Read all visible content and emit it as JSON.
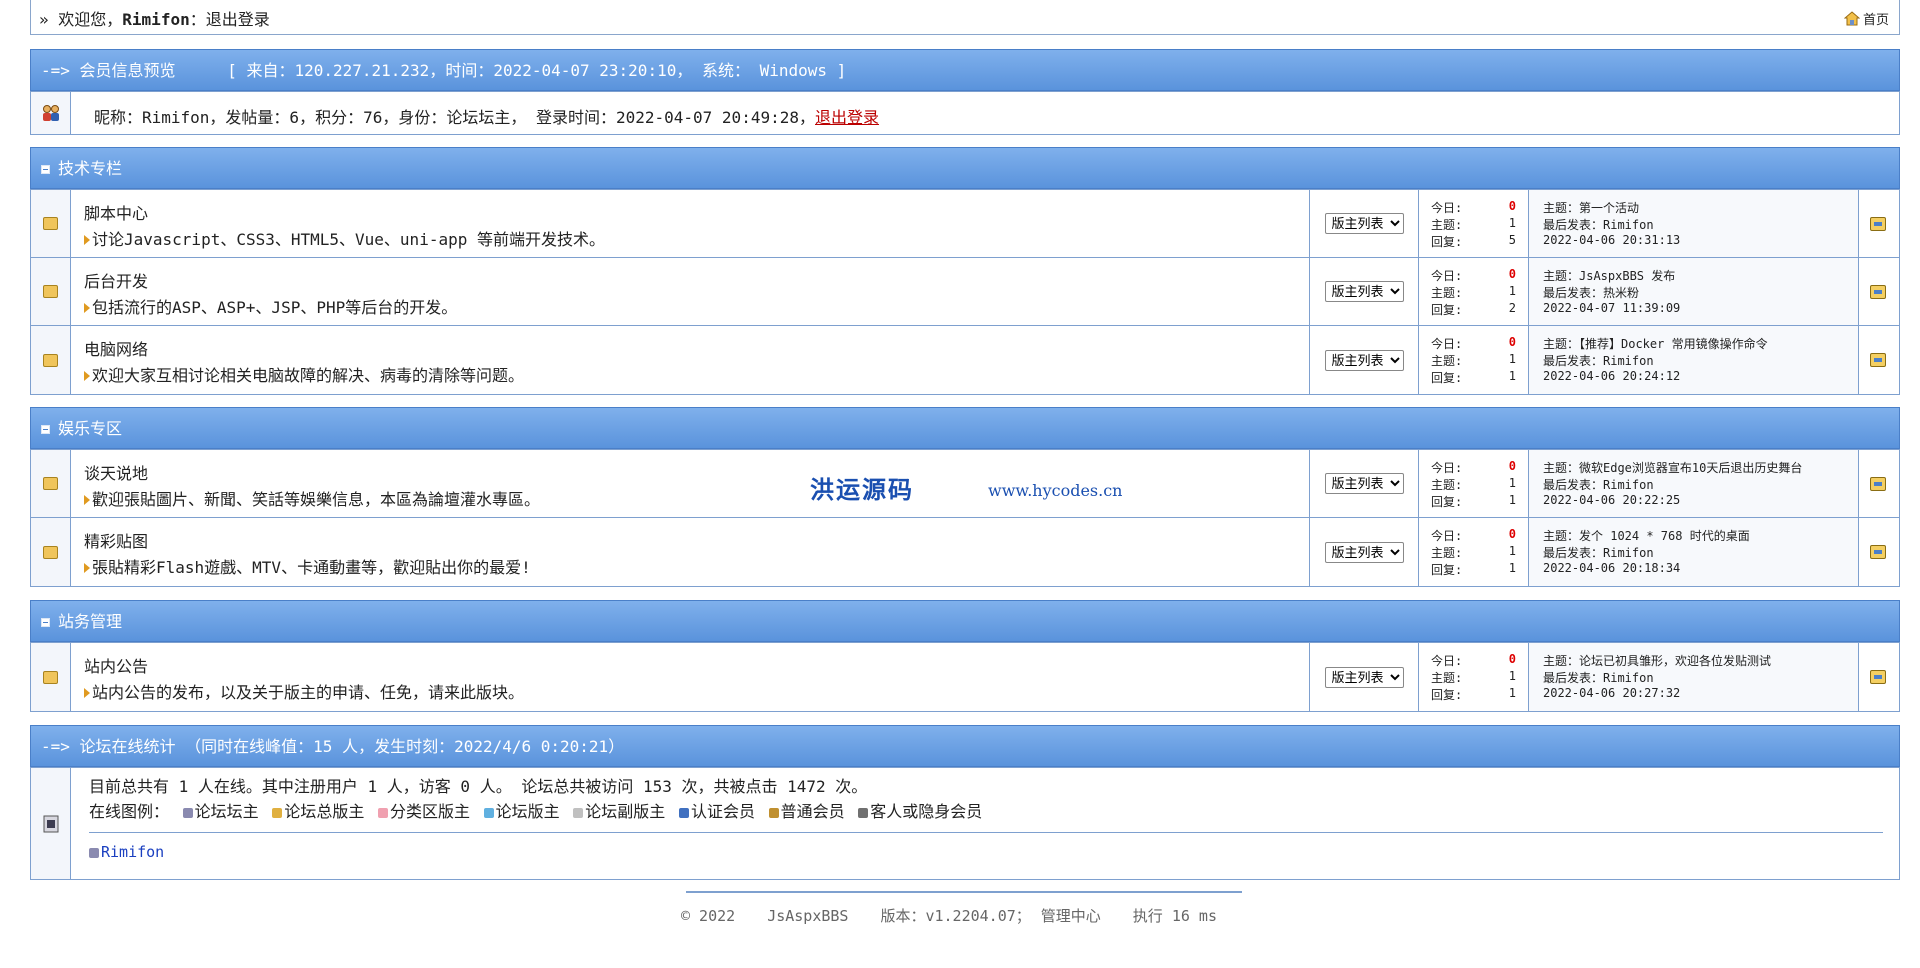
{
  "top": {
    "prefix": "» 欢迎您，",
    "user": "Rimifon",
    "sep": "：",
    "logout": "退出登录",
    "home": "首页"
  },
  "member": {
    "head_label": "-=> 会员信息预览",
    "head_info": "[ 来自：120.227.21.232，时间：2022-04-07 23:20:10，  系统：  Windows ]",
    "line": "昵称：Rimifon，发帖量：6，积分：76，身份：论坛坛主，  登录时间：2022-04-07 20:49:28，",
    "logout": "退出登录"
  },
  "categories": [
    {
      "title": "技术专栏",
      "forums": [
        {
          "name": "脚本中心",
          "desc": "讨论Javascript、CSS3、HTML5、Vue、uni-app 等前端开发技术。",
          "mod": "版主列表",
          "today": "0",
          "topics": "1",
          "replies": "5",
          "last_topic": "主题：第一个活动",
          "last_poster": "最后发表：Rimifon",
          "last_time": "2022-04-06 20:31:13"
        },
        {
          "name": "后台开发",
          "desc": "包括流行的ASP、ASP+、JSP、PHP等后台的开发。",
          "mod": "版主列表",
          "today": "0",
          "topics": "1",
          "replies": "2",
          "last_topic": "主题：JsAspxBBS 发布",
          "last_poster": "最后发表：热米粉",
          "last_time": "2022-04-07 11:39:09"
        },
        {
          "name": "电脑网络",
          "desc": "欢迎大家互相讨论相关电脑故障的解决、病毒的清除等问题。",
          "mod": "版主列表",
          "today": "0",
          "topics": "1",
          "replies": "1",
          "last_topic": "主题：【推荐】Docker 常用镜像操作命令",
          "last_poster": "最后发表：Rimifon",
          "last_time": "2022-04-06 20:24:12"
        }
      ]
    },
    {
      "title": "娱乐专区",
      "forums": [
        {
          "name": "谈天说地",
          "desc": "歡迎張貼圖片、新聞、笑話等娛樂信息，本區為論壇灌水專區。",
          "mod": "版主列表",
          "today": "0",
          "topics": "1",
          "replies": "1",
          "last_topic": "主题：微软Edge浏览器宣布10天后退出历史舞台",
          "last_poster": "最后发表：Rimifon",
          "last_time": "2022-04-06 20:22:25"
        },
        {
          "name": "精彩贴图",
          "desc": "張貼精彩Flash遊戲、MTV、卡通動畫等，歡迎貼出你的最爱!",
          "mod": "版主列表",
          "today": "0",
          "topics": "1",
          "replies": "1",
          "last_topic": "主题：发个 1024 * 768 时代的桌面",
          "last_poster": "最后发表：Rimifon",
          "last_time": "2022-04-06 20:18:34"
        }
      ]
    },
    {
      "title": "站务管理",
      "forums": [
        {
          "name": "站内公告",
          "desc": "站内公告的发布，以及关于版主的申请、任免，请来此版块。",
          "mod": "版主列表",
          "today": "0",
          "topics": "1",
          "replies": "1",
          "last_topic": "主题：论坛已初具雏形，欢迎各位发贴测试",
          "last_poster": "最后发表：Rimifon",
          "last_time": "2022-04-06 20:27:32"
        }
      ]
    }
  ],
  "stat_labels": {
    "today": "今日:",
    "topics": "主题:",
    "replies": "回复:"
  },
  "watermark": {
    "cn": "洪运源码",
    "url": "www.hycodes.cn"
  },
  "online": {
    "head": "-=> 论坛在线统计 （同时在线峰值：15 人，发生时刻：2022/4/6 0:20:21）",
    "summary": "目前总共有 1 人在线。其中注册用户 1 人，访客 0 人。 论坛总共被访问 153 次，共被点击 1472 次。",
    "legend_label": "在线图例：",
    "legend": [
      "论坛坛主",
      "论坛总版主",
      "分类区版主",
      "论坛版主",
      "论坛副版主",
      "认证会员",
      "普通会员",
      "客人或隐身会员"
    ],
    "legend_colors": [
      "#8a8ab0",
      "#e0b040",
      "#f0a0b0",
      "#60b0e0",
      "#c0c0c0",
      "#4070c0",
      "#c09030",
      "#707070"
    ],
    "user": "Rimifon"
  },
  "footer": {
    "copy": "© 2022",
    "app": "JsAspxBBS",
    "version": "版本：v1.2204.07；",
    "admin": "管理中心",
    "exec": "执行 16 ms"
  }
}
